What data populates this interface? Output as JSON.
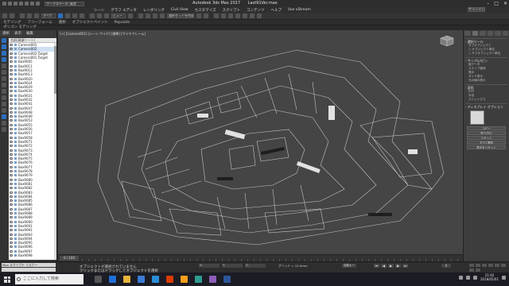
{
  "app": {
    "workspace": "ワークスペース: 既定",
    "title": "Autodesk 3ds Max 2017",
    "file": "Last91Ver.max",
    "signin": "サインイン"
  },
  "menu": [
    "シーン",
    "グラフ エディタ",
    "レンダリング",
    "Civil View",
    "カスタマイズ",
    "スクリプト",
    "コンテンツ",
    "ヘルプ",
    "Vue xStream"
  ],
  "toolbar": {
    "selection_filter": "すべて",
    "view_dropdown": "ビュー",
    "selection_set": "選択セットを作成"
  },
  "ribbon": {
    "tabs": [
      "モデリング",
      "フリーフォーム",
      "選択",
      "オブジェクトペイント",
      "Populate"
    ],
    "sub": "ポリゴン モデリング"
  },
  "explorer": {
    "menu": [
      "選択",
      "表示",
      "編集"
    ],
    "header": "名前(昇順ソート)",
    "rows": [
      "Camera001",
      "Camera002",
      "Camera002.Target",
      "Camera001.Target",
      "Box9005",
      "Box9011",
      "Box9012",
      "Box9013",
      "Box9020",
      "Box9024",
      "Box9029",
      "Box9030",
      "Box9031",
      "Box9032",
      "Box9041",
      "Box9047",
      "Box9048",
      "Box9049",
      "Box9053",
      "Box9055",
      "Box9056",
      "Box9057",
      "Box9058",
      "Box9071",
      "Box9072",
      "Box9073",
      "Box9074",
      "Box9075",
      "Box9076",
      "Box9077",
      "Box9078",
      "Box9079",
      "Box9080",
      "Box9081",
      "Box9082",
      "Box9083",
      "Box9084",
      "Box9085",
      "Box9086",
      "Box9087",
      "Box9088",
      "Box9089",
      "Box9090",
      "Box9091",
      "Box9092",
      "Box9093",
      "Box9094",
      "Box9095",
      "Box9096",
      "Box9097",
      "Box9098"
    ],
    "footer": "ワークスペース: 既定値"
  },
  "viewport": {
    "label": "[+] [Camera001] [シーン ワイヤ] [標準] [ワイヤフレーム]"
  },
  "cmdpanel": {
    "rollouts": [
      {
        "title": "- 選択ツール",
        "lines": [
          "サブオブジェクト",
          "○ オブジェクト単位",
          "○ サブオブジェクト単位"
        ]
      },
      {
        "title": "- サンプル/ピン",
        "lines": [
          "面データ",
          "スナップ使用",
          "表示",
          "ガイド表示",
          "元の値の表示"
        ]
      },
      {
        "title": "- 変形",
        "lines": [
          "XYZ",
          "半径",
          "ストレングス"
        ]
      },
      {
        "title": "- ディスプレイ オプション",
        "lines": []
      }
    ],
    "buttons": [
      "コピー",
      "貼り付け",
      "リセット",
      "すべて選択",
      "表示をリセット"
    ]
  },
  "timeslider": {
    "frame": "0 / 100"
  },
  "status": {
    "maxscript": "Max スクリプト リスナー",
    "line1": "オブジェクトが選択されていません",
    "line2": "クリックまたはドラッグしてオブジェクトを選択",
    "x": "X:",
    "y": "Y:",
    "z": "Z:",
    "grid": "グリッド = 10.0mm",
    "autokey": "自動キー",
    "frame": "0"
  },
  "taskbar": {
    "search": "ここに入力して検索",
    "time": "21:40",
    "date": "2018/05/01"
  },
  "colors": {
    "accent": "#2d6fbf",
    "viewport_bg": "#454545",
    "wire": "#e8e8e8"
  }
}
